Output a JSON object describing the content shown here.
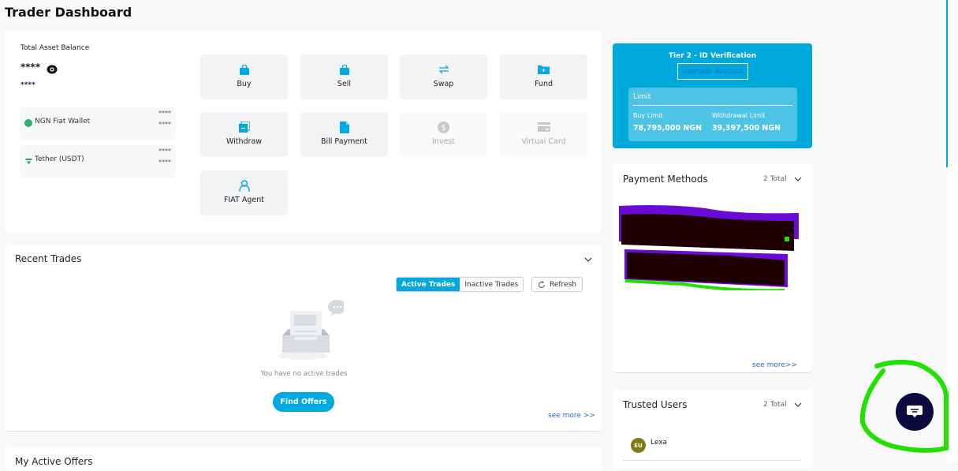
{
  "page": {
    "title": "Trader Dashboard"
  },
  "balance": {
    "label": "Total Asset Balance",
    "main_value": "****",
    "sub_value": "****",
    "wallets": [
      {
        "name": "NGN Fiat Wallet",
        "value1": "****",
        "value2": "****",
        "icon": "naira-coin-icon",
        "color": "#2db36f"
      },
      {
        "name": "Tether (USDT)",
        "value1": "****",
        "value2": "****",
        "icon": "tether-icon",
        "color": "#26a17b"
      }
    ]
  },
  "actions": [
    {
      "label": "Buy",
      "icon": "shopping-bag-icon",
      "enabled": true
    },
    {
      "label": "Sell",
      "icon": "shopping-bag-icon",
      "enabled": true
    },
    {
      "label": "Swap",
      "icon": "swap-arrows-icon",
      "enabled": true
    },
    {
      "label": "Fund",
      "icon": "folder-plus-icon",
      "enabled": true
    },
    {
      "label": "Withdraw",
      "icon": "copy-minus-icon",
      "enabled": true
    },
    {
      "label": "Bill Payment",
      "icon": "document-icon",
      "enabled": true
    },
    {
      "label": "Invest",
      "icon": "dollar-coin-icon",
      "enabled": false
    },
    {
      "label": "Virtual Card",
      "icon": "credit-card-icon",
      "enabled": false
    },
    {
      "label": "FIAT Agent",
      "icon": "user-icon",
      "enabled": true
    }
  ],
  "recent_trades": {
    "title": "Recent Trades",
    "tabs": [
      {
        "label": "Active Trades",
        "active": true
      },
      {
        "label": "Inactive Trades",
        "active": false
      }
    ],
    "refresh_label": "Refresh",
    "empty_text": "You have no active trades",
    "find_offers_label": "Find Offers",
    "see_more_label": "see more >>"
  },
  "active_offers": {
    "title": "My Active Offers"
  },
  "tier": {
    "title": "Tier 2 - ID Verification",
    "upgrade_label": "Upgrade Account",
    "limit_title": "Limit",
    "buy_limit_label": "Buy Limit",
    "buy_limit_value": "78,795,000 NGN",
    "withdrawal_limit_label": "Withdrawal Limit",
    "withdrawal_limit_value": "39,397,500 NGN"
  },
  "payment_methods": {
    "title": "Payment Methods",
    "total": "2 Total",
    "see_more_label": "see more>>"
  },
  "trusted_users": {
    "title": "Trusted Users",
    "total": "2 Total",
    "users": [
      {
        "initials": "EU",
        "name": "Lexa"
      }
    ]
  },
  "colors": {
    "accent": "#00a9e0",
    "chat": "#0b0b3f"
  }
}
